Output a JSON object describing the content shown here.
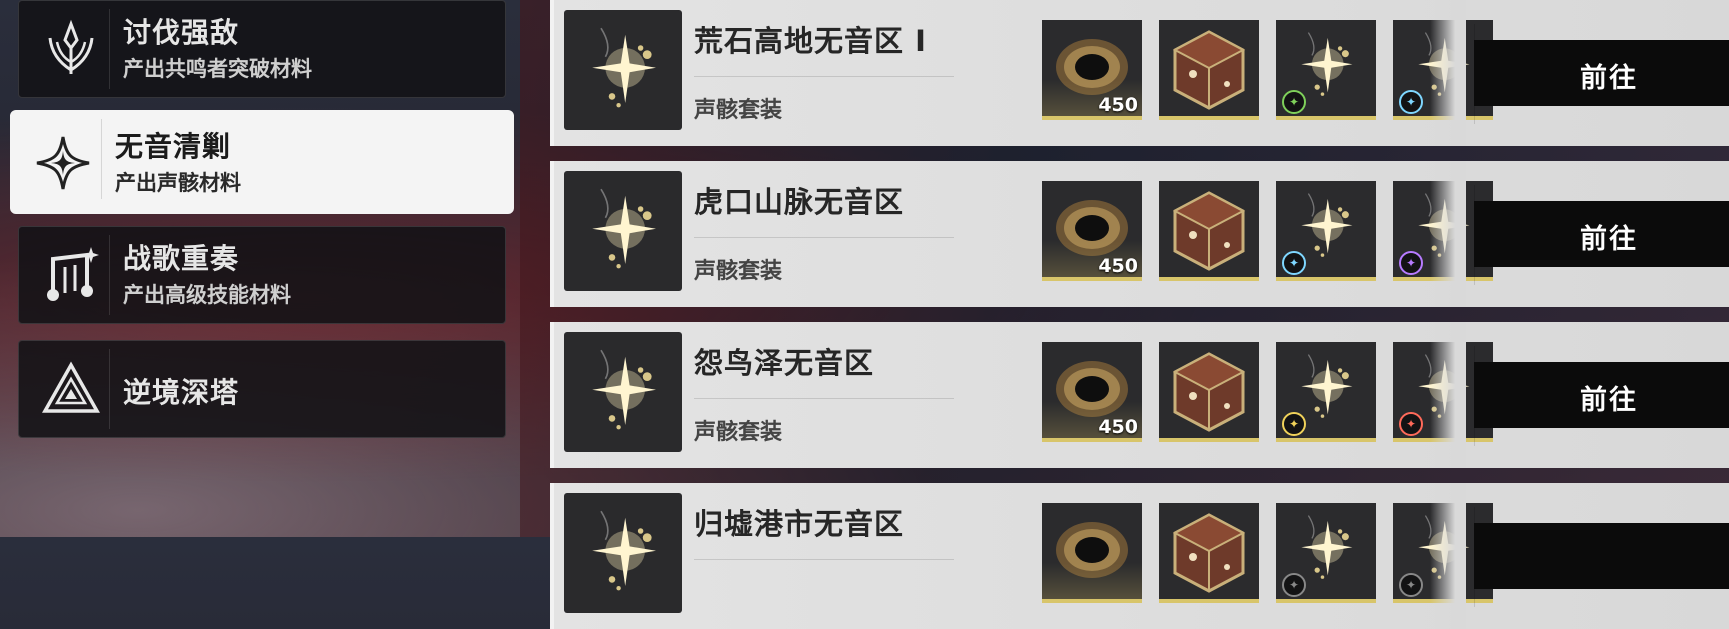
{
  "sidebar": {
    "items": [
      {
        "title": "讨伐强敌",
        "subtitle": "产出共鸣者突破材料",
        "icon": "tacet-emblem-icon"
      },
      {
        "title": "无音清剿",
        "subtitle": "产出声骸材料",
        "icon": "four-point-star-icon"
      },
      {
        "title": "战歌重奏",
        "subtitle": "产出高级技能材料",
        "icon": "music-note-icon"
      },
      {
        "title": "逆境深塔",
        "subtitle": "",
        "icon": "tower-triangle-icon"
      }
    ]
  },
  "rows": [
    {
      "name": "荒石高地无音区 Ⅰ",
      "type": "声骸套装",
      "count": "450",
      "go": "前往",
      "elements": [
        "#7fd05a",
        "#7fd7ff"
      ]
    },
    {
      "name": "虎口山脉无音区",
      "type": "声骸套装",
      "count": "450",
      "go": "前往",
      "elements": [
        "#7fd7ff",
        "#b77bff"
      ]
    },
    {
      "name": "怨鸟泽无音区",
      "type": "声骸套装",
      "count": "450",
      "go": "前往",
      "elements": [
        "#f0d25a",
        "#ff6a5a"
      ]
    },
    {
      "name": "归墟港市无音区",
      "type": "",
      "count": "",
      "go": "",
      "elements": []
    }
  ],
  "colors": {
    "accent_gold": "#d8c56a",
    "button_bg": "#0b0b0b",
    "active_tab_bg": "#f4f4f4"
  }
}
